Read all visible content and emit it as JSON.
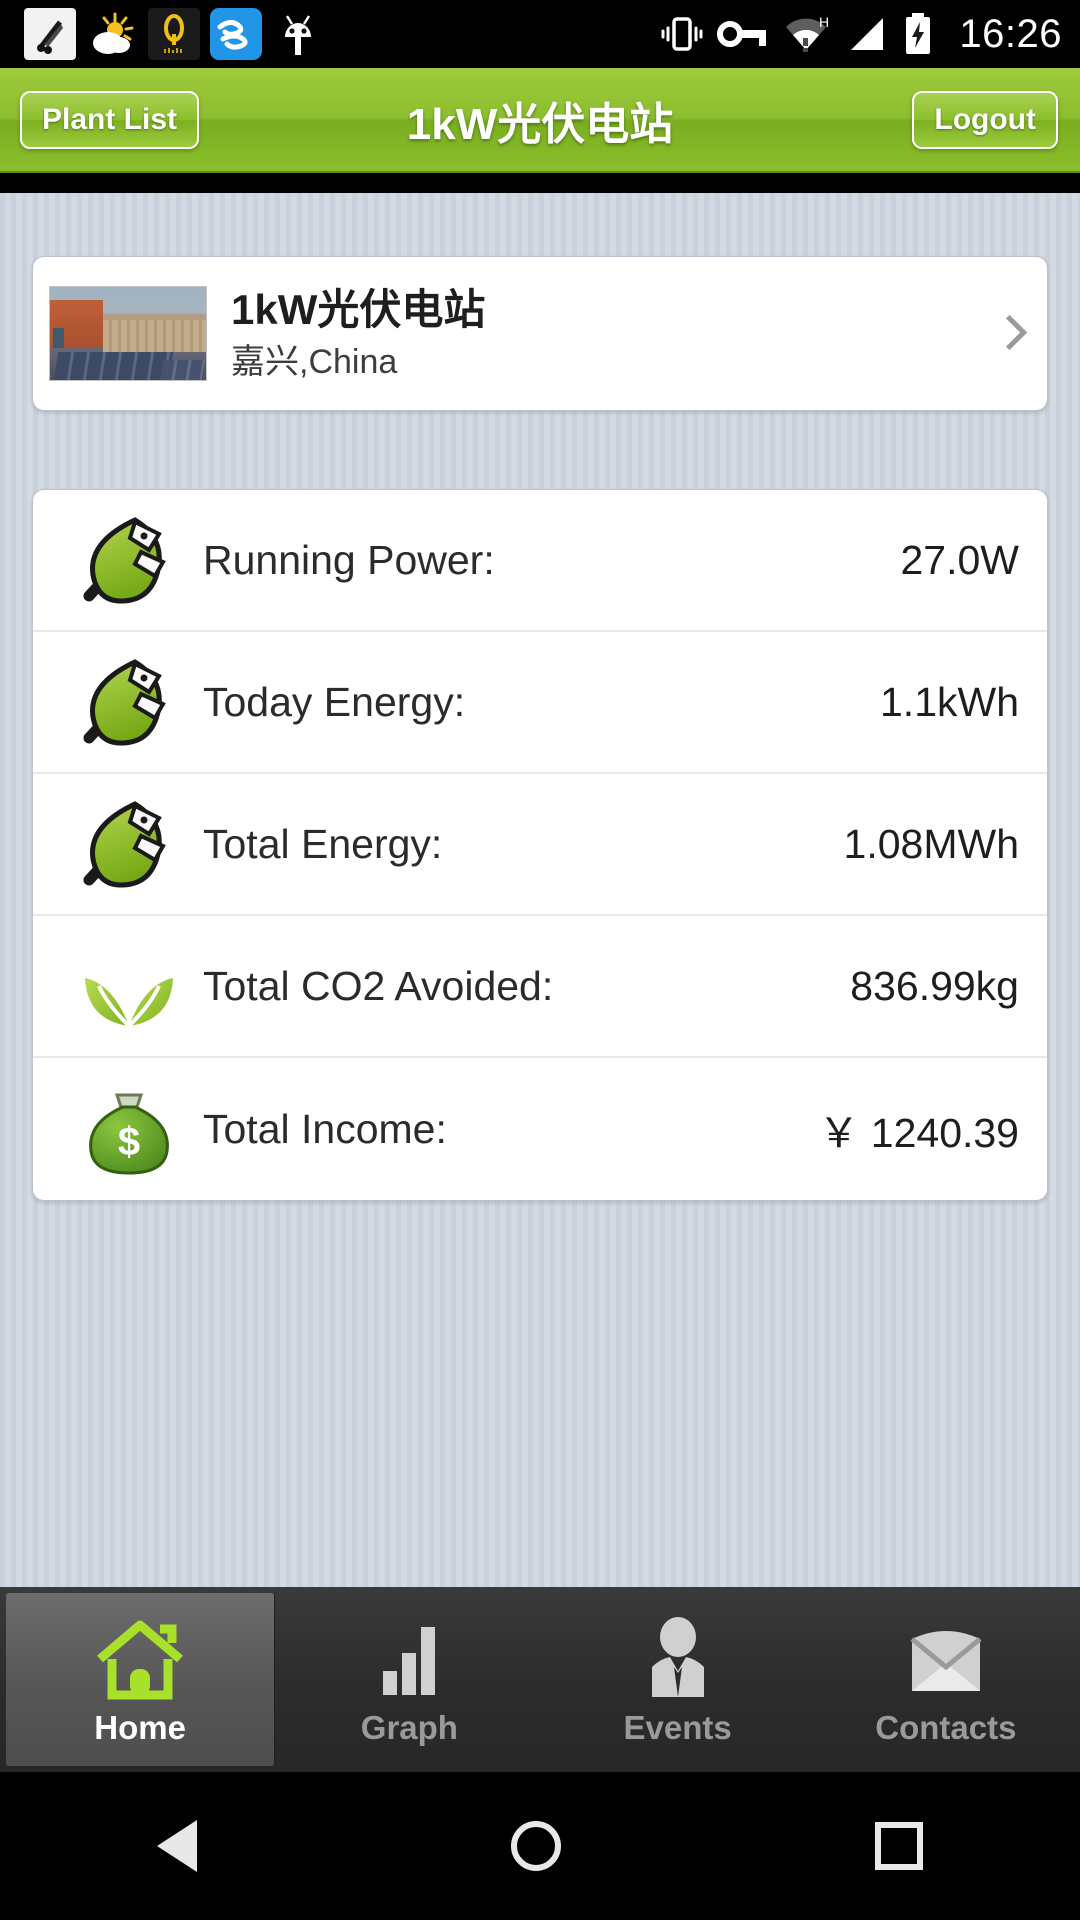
{
  "statusbar": {
    "time": "16:26",
    "notification_icons": [
      "scissors-icon",
      "weather-partly-cloudy-icon",
      "q-music-icon",
      "wind-app-icon",
      "android-robot-icon"
    ],
    "system_icons": [
      "vibrate-icon",
      "vpn-key-icon",
      "wifi-h-icon",
      "signal-icon",
      "battery-charging-icon"
    ]
  },
  "titlebar": {
    "back_label": "Plant List",
    "title": "1kW光伏电站",
    "logout_label": "Logout"
  },
  "plant_card": {
    "name": "1kW光伏电站",
    "location": "嘉兴,China",
    "thumbnail": "solar-plant-photo",
    "chevron": "chevron-right-icon"
  },
  "stats": [
    {
      "icon": "leaf-plug-icon",
      "label": "Running Power:",
      "value": "27.0W"
    },
    {
      "icon": "leaf-plug-icon",
      "label": "Today Energy:",
      "value": "1.1kWh"
    },
    {
      "icon": "leaf-plug-icon",
      "label": "Total Energy:",
      "value": "1.08MWh"
    },
    {
      "icon": "two-leaves-icon",
      "label": "Total CO2 Avoided:",
      "value": "836.99kg"
    },
    {
      "icon": "money-bag-icon",
      "label": "Total Income:",
      "value": "￥ 1240.39"
    }
  ],
  "tabs": [
    {
      "label": "Home",
      "icon": "home-icon",
      "active": true
    },
    {
      "label": "Graph",
      "icon": "bar-chart-icon",
      "active": false
    },
    {
      "label": "Events",
      "icon": "person-tie-icon",
      "active": false
    },
    {
      "label": "Contacts",
      "icon": "envelope-icon",
      "active": false
    }
  ],
  "navbar": {
    "back": "back-triangle-icon",
    "home": "home-circle-icon",
    "recents": "recents-square-icon"
  },
  "colors": {
    "header_green": "#8cbf2c",
    "accent_green": "#9fca3d",
    "background": "#ced5dd",
    "tabbar": "#2c2c2c"
  }
}
